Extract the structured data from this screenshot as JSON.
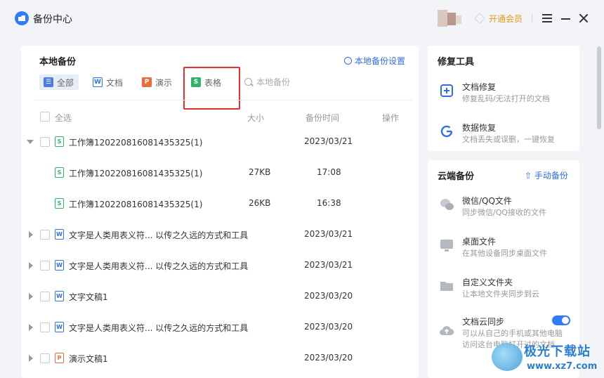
{
  "app": {
    "title": "备份中心"
  },
  "titlebar": {
    "vip_label": "开通会员"
  },
  "main": {
    "title": "本地备份",
    "settings_label": "本地备份设置",
    "tabs": [
      {
        "label": "全部",
        "icon": "list-icon",
        "active": true
      },
      {
        "label": "文档",
        "icon": "word-icon"
      },
      {
        "label": "演示",
        "icon": "ppt-icon"
      },
      {
        "label": "表格",
        "icon": "sheet-icon"
      }
    ],
    "search_placeholder": "本地备份",
    "columns": {
      "select_all": "全选",
      "size": "大小",
      "time": "备份时间",
      "action": "操作"
    },
    "rows": [
      {
        "name": "工作簿120220816081435325(1)",
        "size": "",
        "time": "2023/03/21",
        "type": "sheet",
        "expand": "open",
        "child": false
      },
      {
        "name": "工作簿120220816081435325(1)",
        "size": "27KB",
        "time": "17:08",
        "type": "sheet",
        "expand": "none",
        "child": true
      },
      {
        "name": "工作簿120220816081435325(1)",
        "size": "26KB",
        "time": "16:38",
        "type": "sheet",
        "expand": "none",
        "child": true
      },
      {
        "name": "文字是人类用表义符... 以传之久远的方式和工具",
        "size": "",
        "time": "2023/03/21",
        "type": "word",
        "expand": "closed",
        "child": false
      },
      {
        "name": "文字是人类用表义符... 以传之久远的方式和工具",
        "size": "",
        "time": "2023/03/21",
        "type": "word",
        "expand": "closed",
        "child": false
      },
      {
        "name": "文字文稿1",
        "size": "",
        "time": "2023/03/20",
        "type": "word",
        "expand": "closed",
        "child": false
      },
      {
        "name": "文字是人类用表义符... 以传之久远的方式和工具",
        "size": "",
        "time": "2023/03/20",
        "type": "word",
        "expand": "closed",
        "child": false
      },
      {
        "name": "演示文稿1",
        "size": "",
        "time": "2023/03/20",
        "type": "ppt",
        "expand": "closed",
        "child": false
      }
    ]
  },
  "repair": {
    "title": "修复工具",
    "tools": [
      {
        "name": "文档修复",
        "desc": "修复乱码/无法打开的文档",
        "icon": "doc-repair-icon"
      },
      {
        "name": "数据恢复",
        "desc": "文档丢失或误删，一键恢复",
        "icon": "data-recovery-icon"
      }
    ]
  },
  "cloud": {
    "title": "云端备份",
    "manual_label": "手动备份",
    "items": [
      {
        "name": "微信/QQ文件",
        "desc": "同步微信/QQ接收的文件",
        "icon": "chat-icon"
      },
      {
        "name": "桌面文件",
        "desc": "在其他设备同步桌面文件",
        "icon": "desktop-icon"
      },
      {
        "name": "自定义文件夹",
        "desc": "让本地文件夹同步到云",
        "icon": "folder-icon"
      },
      {
        "name": "文档云同步",
        "desc": "可以从自己的手机或其他电脑",
        "desc2": "访问这台电脑打开过的文档",
        "icon": "cloud-upload-icon",
        "toggle": true
      }
    ]
  },
  "watermark": {
    "text": "极光下载站",
    "url": "www.xz7.com"
  },
  "colors": {
    "accent": "#2f7cf6",
    "highlight": "#e0302f",
    "vip": "#e39a1c",
    "sheet": "#2fb36a",
    "word": "#2f6fe0",
    "ppt": "#ea6b3c"
  }
}
